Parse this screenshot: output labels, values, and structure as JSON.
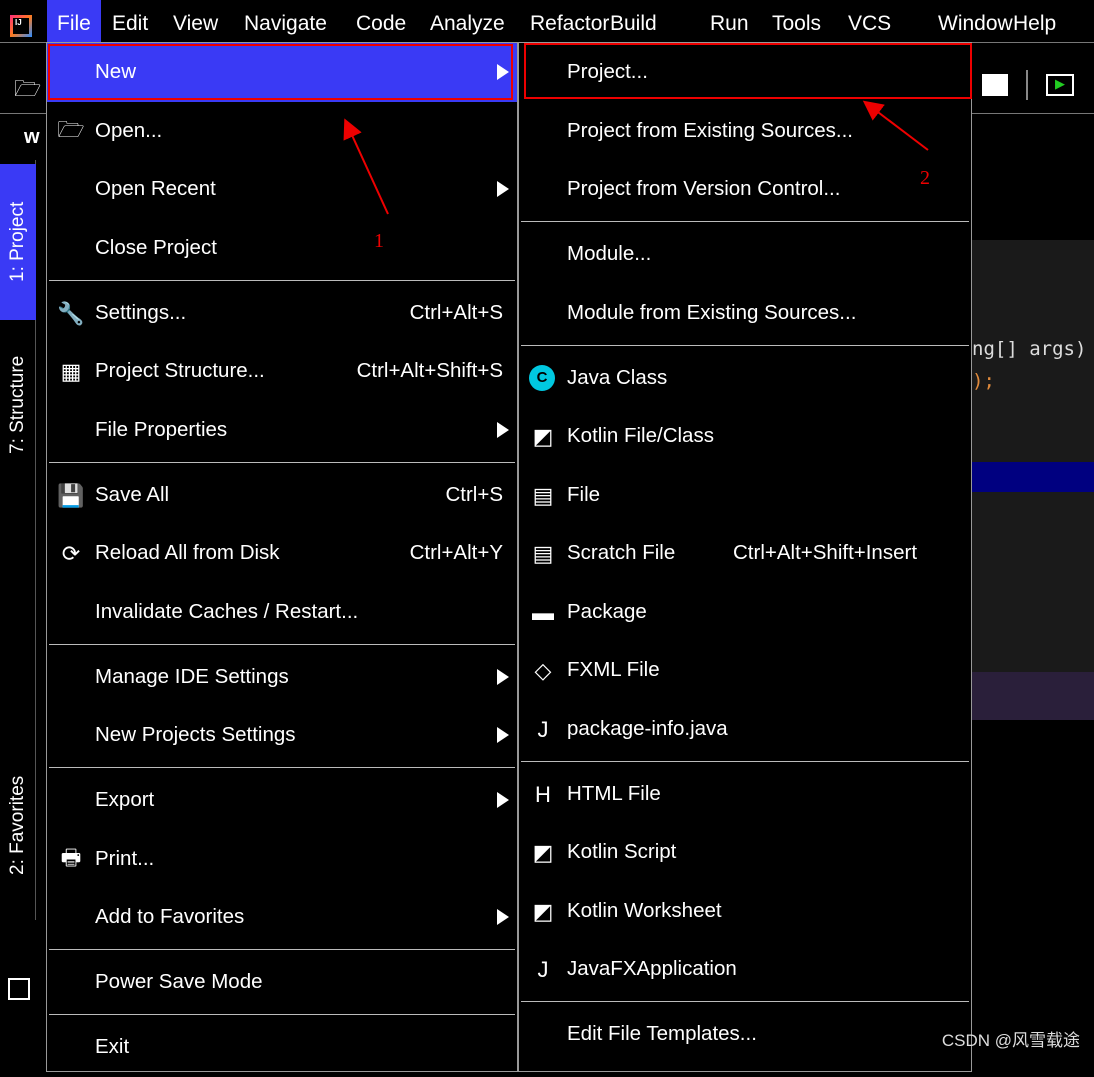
{
  "menubar": {
    "items": [
      "File",
      "Edit",
      "View",
      "Navigate",
      "Code",
      "Analyze",
      "Refactor",
      "Build",
      "Run",
      "Tools",
      "VCS",
      "Window",
      "Help"
    ],
    "active": "File"
  },
  "sidebar": {
    "tabs": [
      "1: Project",
      "7: Structure",
      "2: Favorites"
    ]
  },
  "editor": {
    "project_label": "w",
    "code_lines": [
      "ng[] args)",
      ");"
    ]
  },
  "file_menu": [
    {
      "label": "New",
      "icon": "none",
      "submenu": true,
      "selected": true
    },
    {
      "label": "Open...",
      "icon": "folder-open-icon"
    },
    {
      "label": "Open Recent",
      "submenu": true
    },
    {
      "label": "Close Project"
    },
    {
      "sep": true
    },
    {
      "label": "Settings...",
      "icon": "wrench-icon",
      "shortcut": "Ctrl+Alt+S"
    },
    {
      "label": "Project Structure...",
      "icon": "project-structure-icon",
      "shortcut": "Ctrl+Alt+Shift+S"
    },
    {
      "label": "File Properties",
      "submenu": true
    },
    {
      "sep": true
    },
    {
      "label": "Save All",
      "icon": "save-icon",
      "shortcut": "Ctrl+S"
    },
    {
      "label": "Reload All from Disk",
      "icon": "reload-icon",
      "shortcut": "Ctrl+Alt+Y"
    },
    {
      "label": "Invalidate Caches / Restart..."
    },
    {
      "sep": true
    },
    {
      "label": "Manage IDE Settings",
      "submenu": true
    },
    {
      "label": "New Projects Settings",
      "submenu": true
    },
    {
      "sep": true
    },
    {
      "label": "Export",
      "submenu": true
    },
    {
      "label": "Print...",
      "icon": "print-icon"
    },
    {
      "label": "Add to Favorites",
      "submenu": true
    },
    {
      "sep": true
    },
    {
      "label": "Power Save Mode"
    },
    {
      "sep": true
    },
    {
      "label": "Exit"
    }
  ],
  "new_submenu": [
    {
      "label": "Project..."
    },
    {
      "label": "Project from Existing Sources..."
    },
    {
      "label": "Project from Version Control..."
    },
    {
      "sep": true
    },
    {
      "label": "Module..."
    },
    {
      "label": "Module from Existing Sources..."
    },
    {
      "sep": true
    },
    {
      "label": "Java Class",
      "icon": "java-class-icon"
    },
    {
      "label": "Kotlin File/Class",
      "icon": "kotlin-file-icon"
    },
    {
      "label": "File",
      "icon": "file-icon"
    },
    {
      "label": "Scratch File",
      "icon": "scratch-file-icon",
      "shortcut": "Ctrl+Alt+Shift+Insert"
    },
    {
      "label": "Package",
      "icon": "package-icon"
    },
    {
      "label": "FXML File",
      "icon": "fxml-file-icon"
    },
    {
      "label": "package-info.java",
      "icon": "package-info-icon"
    },
    {
      "sep": true
    },
    {
      "label": "HTML File",
      "icon": "html-file-icon"
    },
    {
      "label": "Kotlin Script",
      "icon": "kotlin-script-icon"
    },
    {
      "label": "Kotlin Worksheet",
      "icon": "kotlin-worksheet-icon"
    },
    {
      "label": "JavaFXApplication",
      "icon": "javafx-icon"
    },
    {
      "sep": true
    },
    {
      "label": "Edit File Templates..."
    }
  ],
  "annotations": {
    "label1": "1",
    "label2": "2",
    "color": "#e00000"
  },
  "colors": {
    "selection": "#3a3af5",
    "background": "#000000"
  },
  "watermark": "CSDN @风雪载途"
}
